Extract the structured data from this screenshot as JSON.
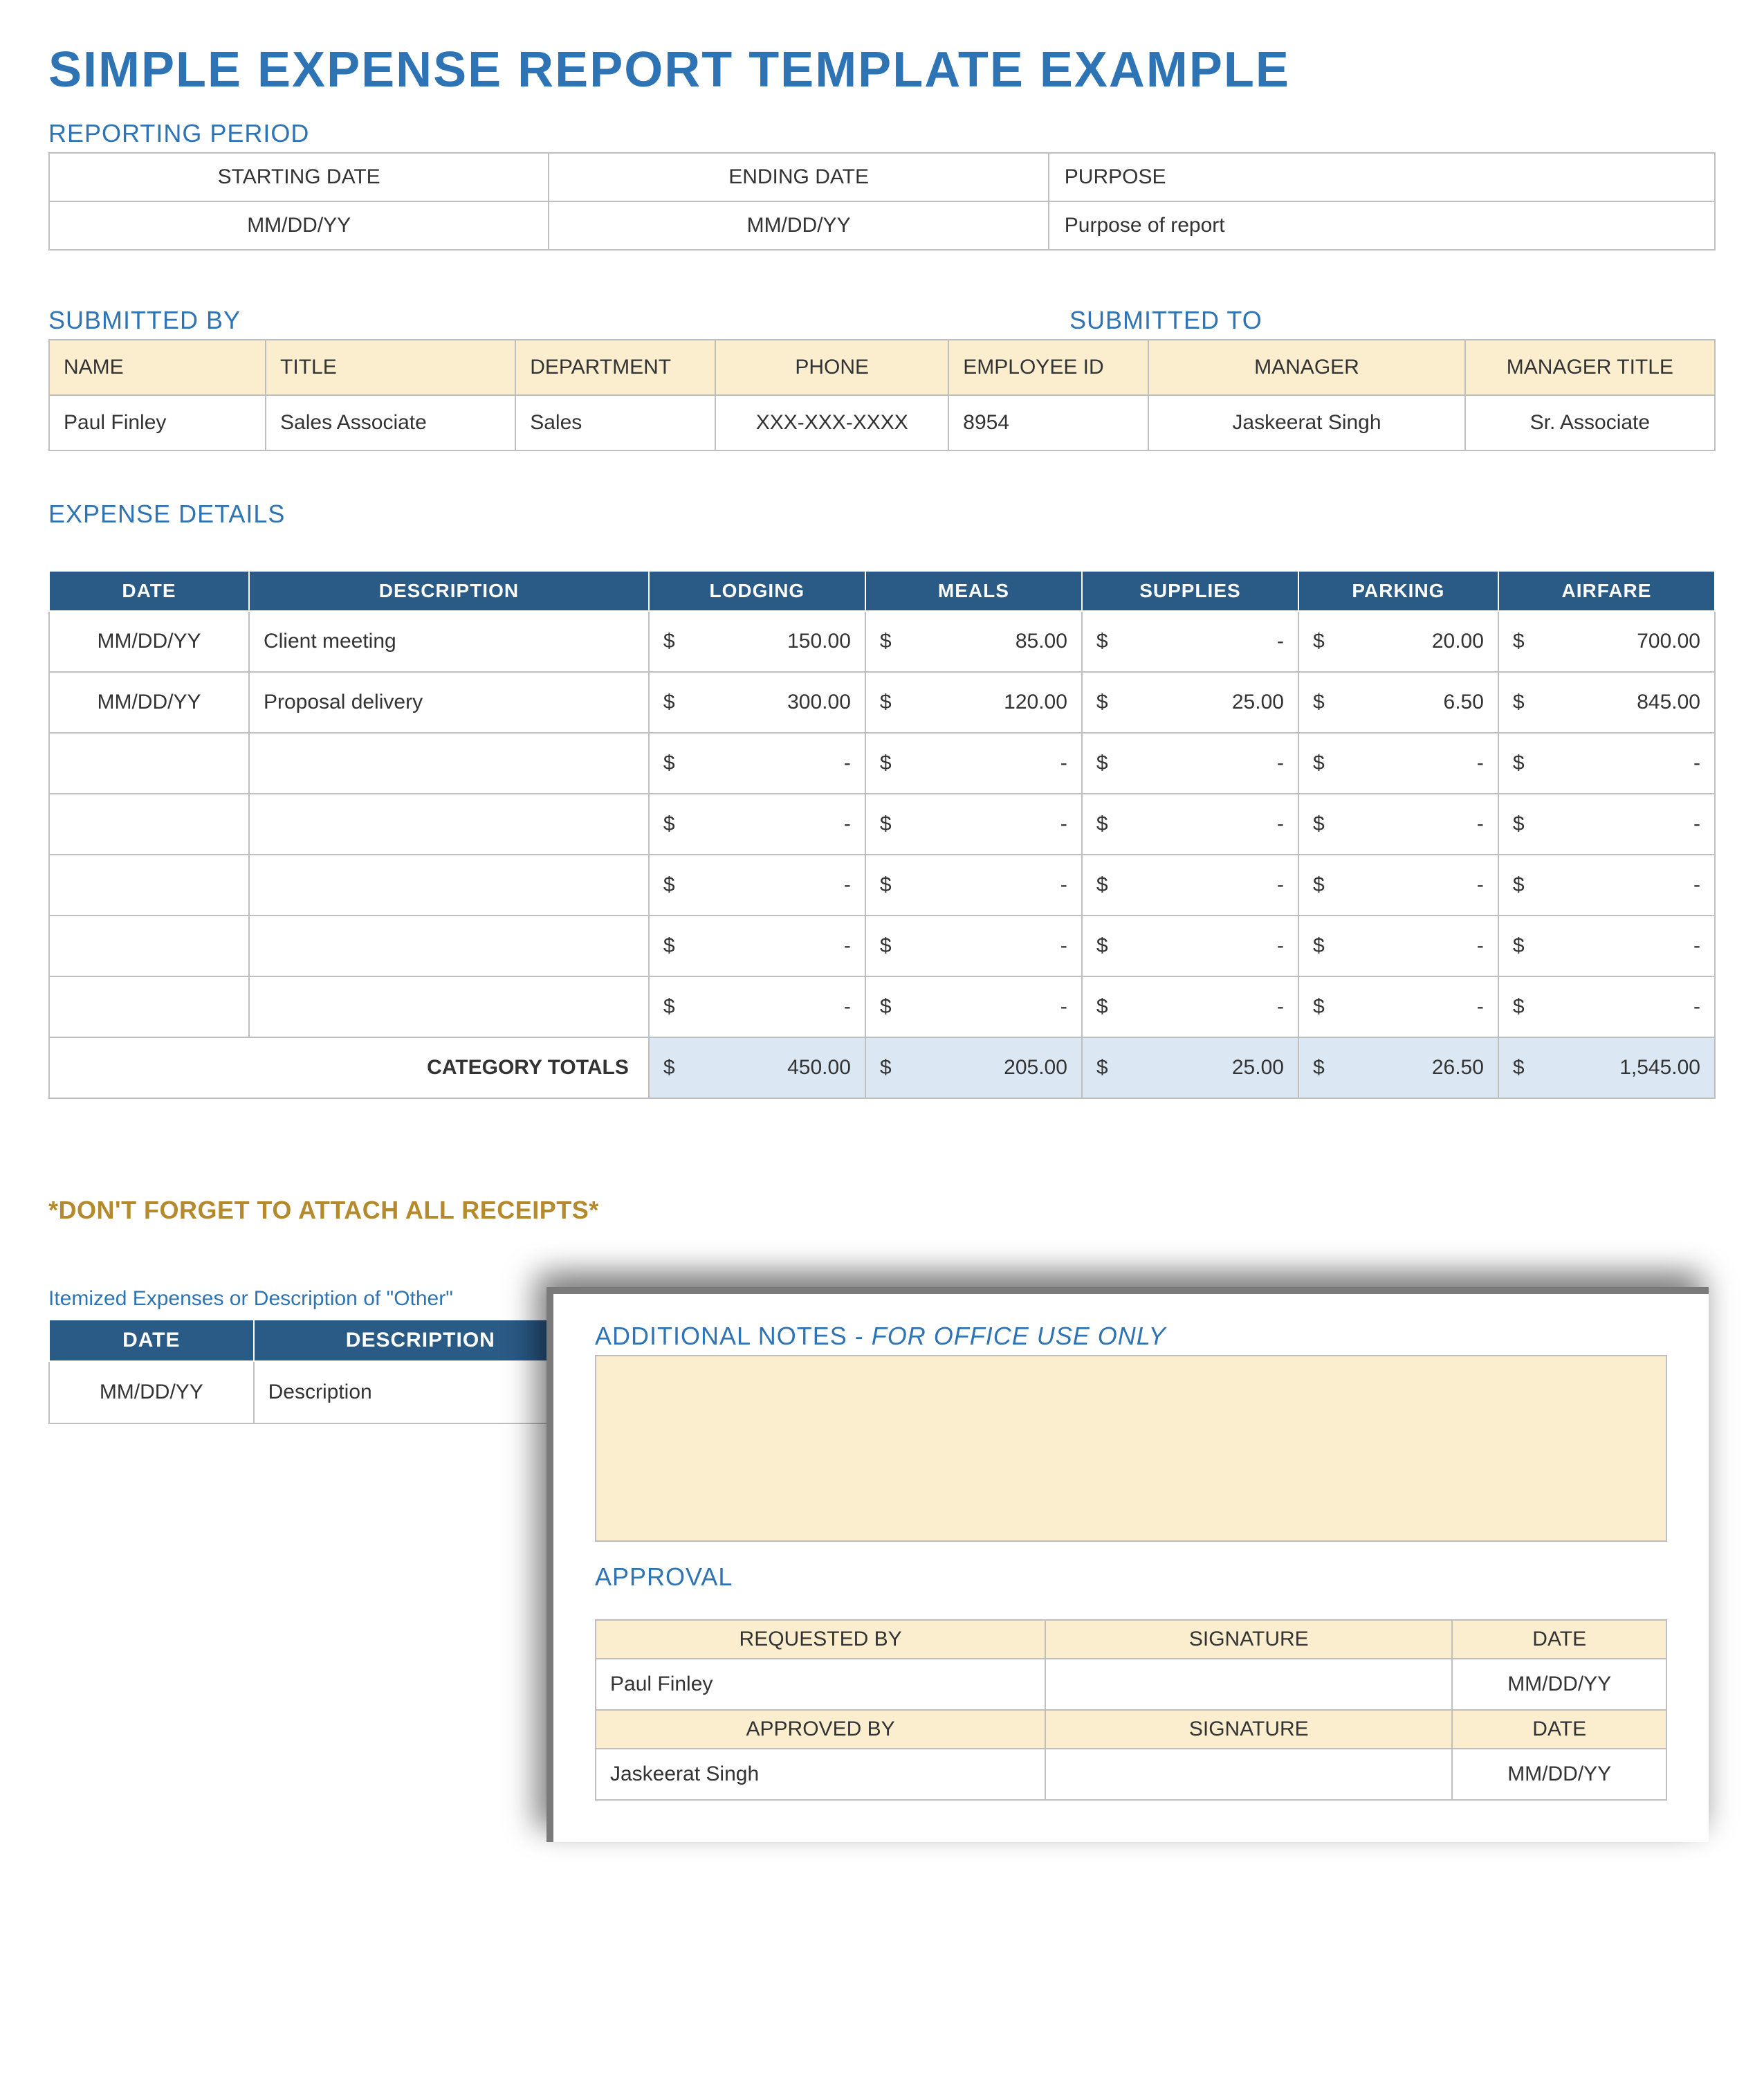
{
  "title": "SIMPLE EXPENSE REPORT TEMPLATE EXAMPLE",
  "reportingPeriod": {
    "label": "REPORTING PERIOD",
    "headers": {
      "start": "STARTING DATE",
      "end": "ENDING DATE",
      "purpose": "PURPOSE"
    },
    "values": {
      "start": "MM/DD/YY",
      "end": "MM/DD/YY",
      "purpose": "Purpose of report"
    }
  },
  "submitted": {
    "byLabel": "SUBMITTED BY",
    "toLabel": "SUBMITTED TO",
    "headers": {
      "name": "NAME",
      "title": "TITLE",
      "dept": "DEPARTMENT",
      "phone": "PHONE",
      "empid": "EMPLOYEE ID",
      "manager": "MANAGER",
      "mgrtitle": "MANAGER TITLE"
    },
    "values": {
      "name": "Paul Finley",
      "title": "Sales Associate",
      "dept": "Sales",
      "phone": "XXX-XXX-XXXX",
      "empid": "8954",
      "manager": "Jaskeerat Singh",
      "mgrtitle": "Sr. Associate"
    }
  },
  "expense": {
    "label": "EXPENSE DETAILS",
    "headers": {
      "date": "DATE",
      "desc": "DESCRIPTION",
      "lodging": "LODGING",
      "meals": "MEALS",
      "supplies": "SUPPLIES",
      "parking": "PARKING",
      "airfare": "AIRFARE"
    },
    "currency": "$",
    "dash": "-",
    "rows": [
      {
        "date": "MM/DD/YY",
        "desc": "Client meeting",
        "lodging": "150.00",
        "meals": "85.00",
        "supplies": "-",
        "parking": "20.00",
        "airfare": "700.00"
      },
      {
        "date": "MM/DD/YY",
        "desc": "Proposal delivery",
        "lodging": "300.00",
        "meals": "120.00",
        "supplies": "25.00",
        "parking": "6.50",
        "airfare": "845.00"
      },
      {
        "date": "",
        "desc": "",
        "lodging": "-",
        "meals": "-",
        "supplies": "-",
        "parking": "-",
        "airfare": "-"
      },
      {
        "date": "",
        "desc": "",
        "lodging": "-",
        "meals": "-",
        "supplies": "-",
        "parking": "-",
        "airfare": "-"
      },
      {
        "date": "",
        "desc": "",
        "lodging": "-",
        "meals": "-",
        "supplies": "-",
        "parking": "-",
        "airfare": "-"
      },
      {
        "date": "",
        "desc": "",
        "lodging": "-",
        "meals": "-",
        "supplies": "-",
        "parking": "-",
        "airfare": "-"
      },
      {
        "date": "",
        "desc": "",
        "lodging": "-",
        "meals": "-",
        "supplies": "-",
        "parking": "-",
        "airfare": "-"
      }
    ],
    "totalsLabel": "CATEGORY TOTALS",
    "totals": {
      "lodging": "450.00",
      "meals": "205.00",
      "supplies": "25.00",
      "parking": "26.50",
      "airfare": "1,545.00"
    }
  },
  "attachNote": "*DON'T FORGET TO ATTACH ALL RECEIPTS*",
  "itemized": {
    "label": "Itemized Expenses or Description of \"Other\"",
    "headers": {
      "date": "DATE",
      "desc": "DESCRIPTION"
    },
    "row": {
      "date": "MM/DD/YY",
      "desc": "Description"
    }
  },
  "notes": {
    "label": "ADDITIONAL NOTES - ",
    "labelItalic": "FOR OFFICE USE ONLY"
  },
  "approval": {
    "label": "APPROVAL",
    "headers": {
      "reqby": "REQUESTED BY",
      "sig": "SIGNATURE",
      "date": "DATE",
      "appby": "APPROVED BY"
    },
    "requestedBy": "Paul Finley",
    "requestedDate": "MM/DD/YY",
    "approvedBy": "Jaskeerat Singh",
    "approvedDate": "MM/DD/YY"
  }
}
